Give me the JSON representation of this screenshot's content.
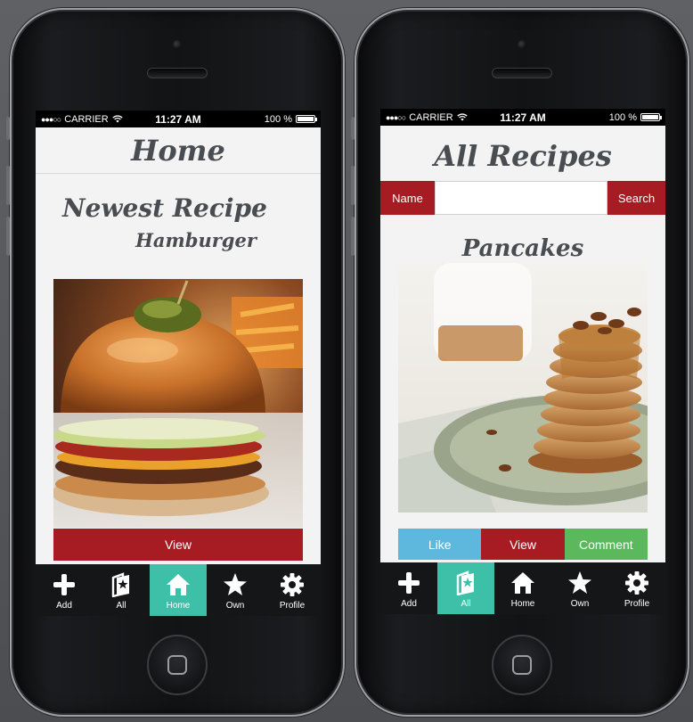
{
  "status": {
    "carrier": "CARRIER",
    "time": "11:27 AM",
    "battery": "100 %"
  },
  "home_screen": {
    "title": "Home",
    "section_title": "Newest Recipe",
    "dish_name": "Hamburger",
    "view_label": "View"
  },
  "recipes_screen": {
    "title": "All Recipes",
    "search": {
      "name_label": "Name",
      "placeholder": "",
      "button_label": "Search"
    },
    "dish_name": "Pancakes",
    "actions": {
      "like": "Like",
      "view": "View",
      "comment": "Comment"
    }
  },
  "tabs": [
    {
      "label": "Add",
      "icon": "plus-icon"
    },
    {
      "label": "All",
      "icon": "recipe-book-icon"
    },
    {
      "label": "Home",
      "icon": "house-icon"
    },
    {
      "label": "Own",
      "icon": "star-icon"
    },
    {
      "label": "Profile",
      "icon": "gear-icon"
    }
  ],
  "active_tab_left": "Home",
  "active_tab_right": "All",
  "colors": {
    "accent_teal": "#3dbfa8",
    "brand_red": "#a71c23",
    "like_blue": "#5eb7dc",
    "comment_green": "#5cb85c",
    "tabbar_bg": "#151618"
  }
}
